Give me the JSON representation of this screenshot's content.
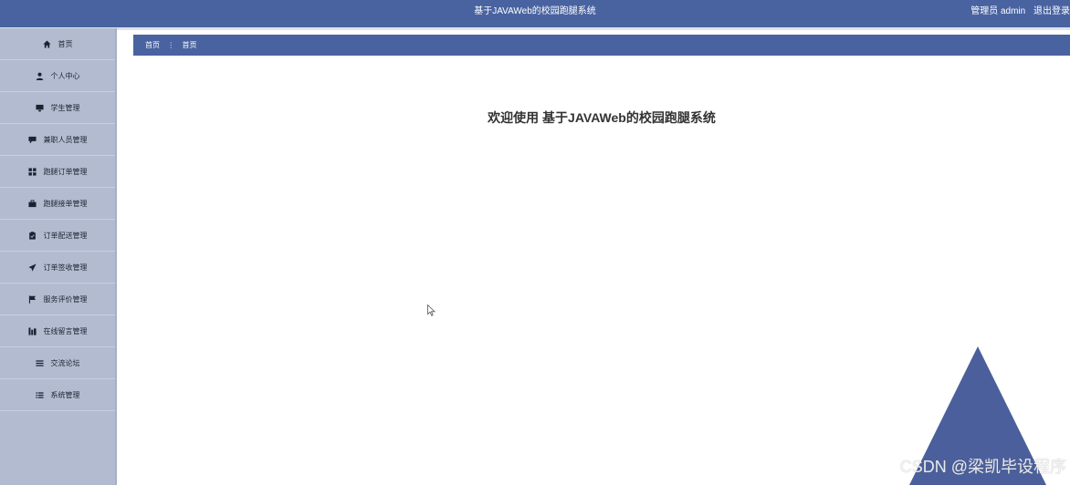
{
  "header": {
    "title": "基于JAVAWeb的校园跑腿系统",
    "user_label": "管理员 admin",
    "logout_label": "退出登录"
  },
  "sidebar": {
    "items": [
      {
        "label": "首页",
        "icon": "home-icon"
      },
      {
        "label": "个人中心",
        "icon": "user-icon"
      },
      {
        "label": "学生管理",
        "icon": "monitor-icon"
      },
      {
        "label": "兼职人员管理",
        "icon": "comment-icon"
      },
      {
        "label": "跑腿订单管理",
        "icon": "grid-icon"
      },
      {
        "label": "跑腿接单管理",
        "icon": "briefcase-icon"
      },
      {
        "label": "订单配送管理",
        "icon": "clipboard-icon"
      },
      {
        "label": "订单签收管理",
        "icon": "send-icon"
      },
      {
        "label": "服务评价管理",
        "icon": "flag-icon"
      },
      {
        "label": "在线留言管理",
        "icon": "chart-icon"
      },
      {
        "label": "交流论坛",
        "icon": "list-icon"
      },
      {
        "label": "系统管理",
        "icon": "list-check-icon"
      }
    ]
  },
  "breadcrumb": {
    "home": "首页",
    "separator": "⋮",
    "current": "首页"
  },
  "main": {
    "welcome": "欢迎使用 基于JAVAWeb的校园跑腿系统"
  },
  "watermark": "CSDN @梁凯毕设程序",
  "colors": {
    "header_bg": "#4963a0",
    "sidebar_bg": "#b2bbd0",
    "accent": "#4a5f9b"
  }
}
